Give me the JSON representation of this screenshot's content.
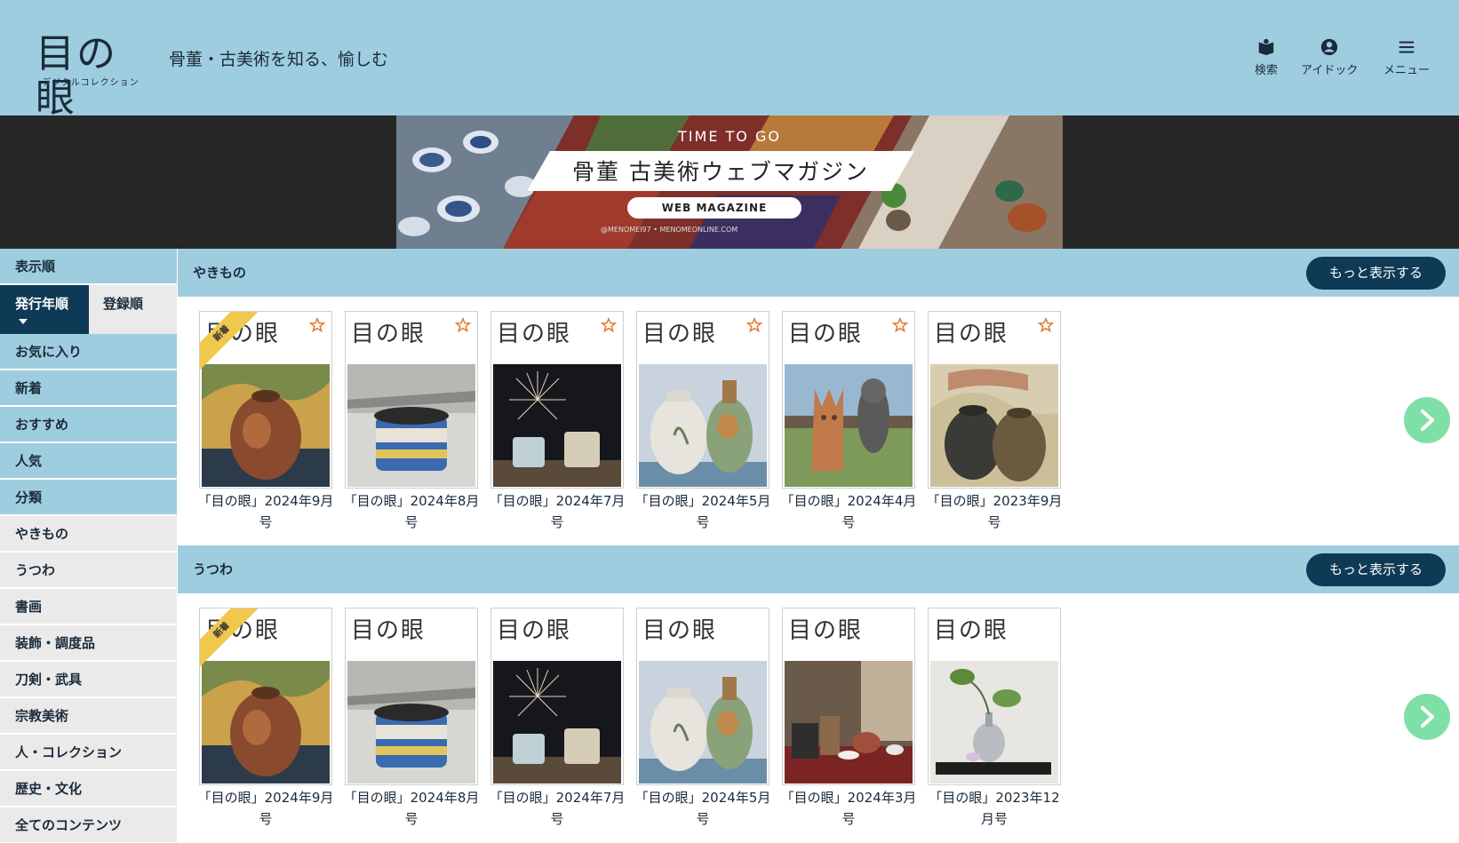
{
  "header": {
    "logo_text": "目の眼",
    "logo_sub": "デジタルコレクション",
    "tagline": "骨董・古美術を知る、愉しむ",
    "nav": [
      {
        "label": "検索",
        "icon": "book-search-icon"
      },
      {
        "label": "アイドック",
        "icon": "account-icon"
      },
      {
        "label": "メニュー",
        "icon": "hamburger-menu-icon"
      }
    ]
  },
  "banner": {
    "kicker": "TIME TO GO",
    "title": "骨董 古美術ウェブマガジン",
    "pill": "WEB MAGAZINE",
    "small": "@MENOMEI97  •  MENOMEONLINE.COM"
  },
  "sidebar": {
    "sort_heading": "表示順",
    "sort_options": [
      "発行年順",
      "登録順"
    ],
    "items": [
      "お気に入り",
      "新着",
      "おすすめ",
      "人気",
      "分類",
      "やきもの",
      "うつわ",
      "書画",
      "装飾・調度品",
      "刀剣・武具",
      "宗教美術",
      "人・コレクション",
      "歴史・文化",
      "全てのコンテンツ"
    ]
  },
  "sections": [
    {
      "title": "やきもの",
      "more": "もっと表示する",
      "items": [
        {
          "caption": "「目の眼」2024年9月号",
          "ribbon": "新着",
          "art": "jar"
        },
        {
          "caption": "「目の眼」2024年8月号",
          "ribbon": "",
          "art": "pot"
        },
        {
          "caption": "「目の眼」2024年7月号",
          "ribbon": "",
          "art": "fireworks"
        },
        {
          "caption": "「目の眼」2024年5月号",
          "ribbon": "",
          "art": "vases"
        },
        {
          "caption": "「目の眼」2024年4月号",
          "ribbon": "",
          "art": "haniwa"
        },
        {
          "caption": "「目の眼」2023年9月号",
          "ribbon": "",
          "art": "twojars"
        }
      ]
    },
    {
      "title": "うつわ",
      "more": "もっと表示する",
      "items": [
        {
          "caption": "「目の眼」2024年9月号",
          "ribbon": "新着",
          "art": "jar"
        },
        {
          "caption": "「目の眼」2024年8月号",
          "ribbon": "",
          "art": "pot"
        },
        {
          "caption": "「目の眼」2024年7月号",
          "ribbon": "",
          "art": "fireworks"
        },
        {
          "caption": "「目の眼」2024年5月号",
          "ribbon": "",
          "art": "vases"
        },
        {
          "caption": "「目の眼」2024年3月号",
          "ribbon": "",
          "art": "teaset"
        },
        {
          "caption": "「目の眼」2023年12月号",
          "ribbon": "",
          "art": "ikebana"
        }
      ]
    }
  ],
  "colors": {
    "header_bg": "#9fcde0",
    "navy": "#0f3a55",
    "next_btn": "#7ee0a6",
    "ribbon": "#f1c84e"
  }
}
